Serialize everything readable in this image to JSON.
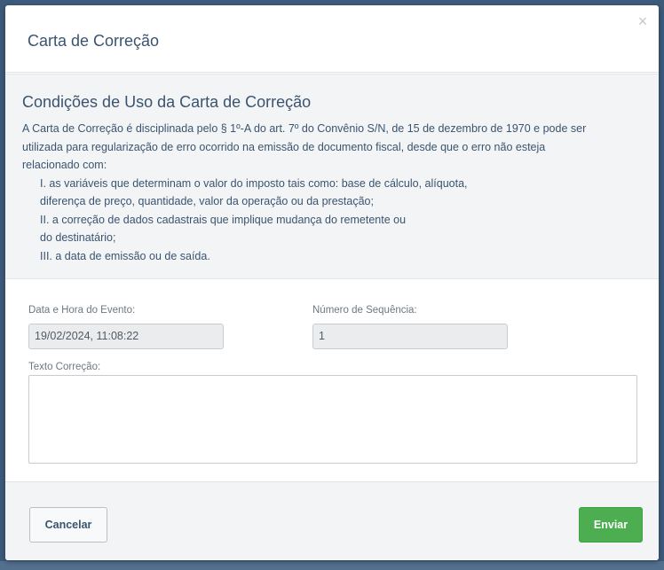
{
  "modal": {
    "title": "Carta de Correção",
    "close_icon": "×"
  },
  "conditions": {
    "title": "Condições de Uso da Carta de Correção",
    "intro_lines": [
      "A Carta de Correção é disciplinada pelo § 1º-A do art. 7º do Convênio S/N, de 15 de dezembro de 1970 e pode ser",
      "utilizada para regularização de erro ocorrido na emissão de documento fiscal, desde que o erro não esteja",
      "relacionado com:"
    ],
    "items": [
      "I. as variáveis que determinam o valor do imposto tais como: base de cálculo, alíquota,",
      "diferença de preço, quantidade, valor da operação ou da prestação;",
      "II. a correção de dados cadastrais que implique mudança do remetente ou",
      "do destinatário;",
      "III. a data de emissão ou de saída."
    ]
  },
  "form": {
    "event_datetime_label": "Data e Hora do Evento:",
    "event_datetime_value": "19/02/2024, 11:08:22",
    "sequence_label": "Número de Sequência:",
    "sequence_value": "1",
    "correction_text_label": "Texto Correção:",
    "correction_text_value": ""
  },
  "footer": {
    "cancel_label": "Cancelar",
    "send_label": "Enviar"
  },
  "colors": {
    "primary_text": "#3a5470",
    "send_button": "#4cae51",
    "backdrop": "#3d5a7a"
  }
}
